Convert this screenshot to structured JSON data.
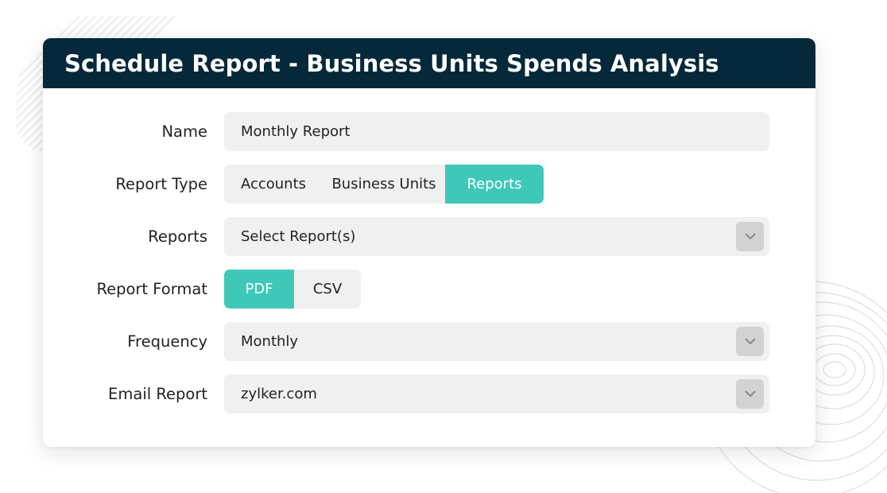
{
  "dialog": {
    "title": "Schedule Report - Business Units Spends Analysis"
  },
  "form": {
    "name": {
      "label": "Name",
      "value": "Monthly Report"
    },
    "report_type": {
      "label": "Report Type",
      "options": [
        "Accounts",
        "Business Units",
        "Reports"
      ],
      "selected": "Reports"
    },
    "reports": {
      "label": "Reports",
      "placeholder": "Select Report(s)"
    },
    "report_format": {
      "label": "Report Format",
      "options": [
        "PDF",
        "CSV"
      ],
      "selected": "PDF"
    },
    "frequency": {
      "label": "Frequency",
      "value": "Monthly"
    },
    "email_report": {
      "label": "Email Report",
      "value": "zylker.com"
    }
  },
  "icons": {
    "dropdown": "chevron-down-icon"
  },
  "colors": {
    "header_bg": "#05293a",
    "accent": "#3fc8b8",
    "field_bg": "#f0f0f0",
    "dropdown_button_bg": "#d2d2d2"
  }
}
